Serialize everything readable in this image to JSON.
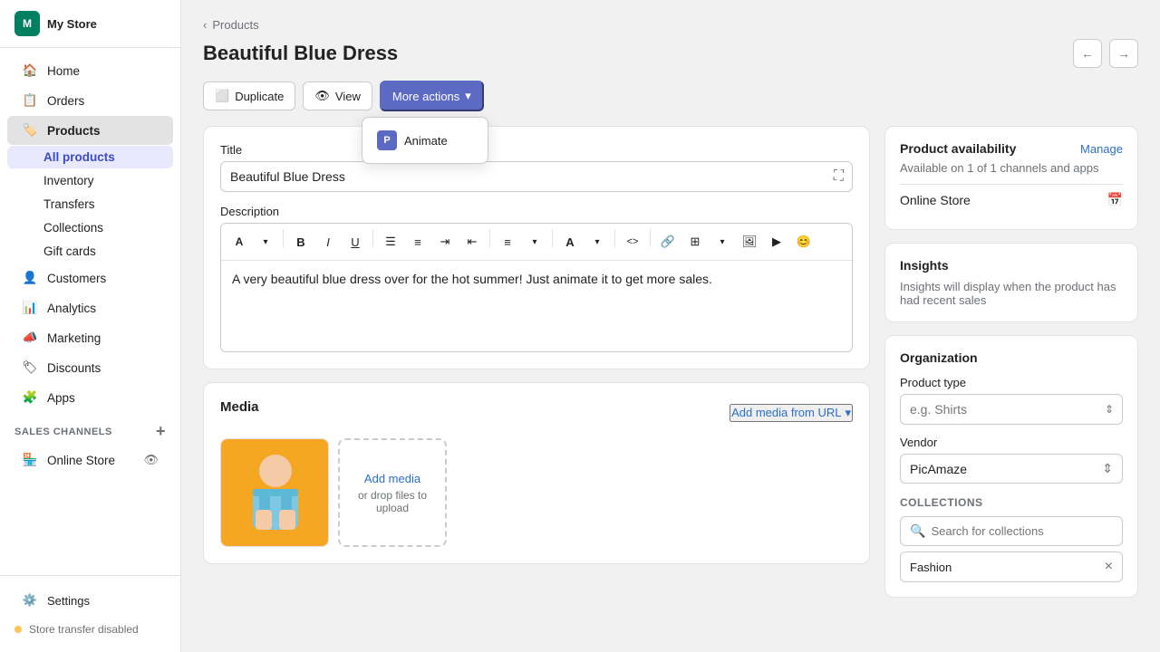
{
  "sidebar": {
    "store": {
      "name": "My Store",
      "initial": "M"
    },
    "nav": [
      {
        "id": "home",
        "label": "Home",
        "icon": "🏠"
      },
      {
        "id": "orders",
        "label": "Orders",
        "icon": "📋"
      },
      {
        "id": "products",
        "label": "Products",
        "icon": "🏷️",
        "active": true
      }
    ],
    "products_sub": [
      {
        "id": "all-products",
        "label": "All products",
        "active": true
      },
      {
        "id": "inventory",
        "label": "Inventory"
      },
      {
        "id": "transfers",
        "label": "Transfers"
      },
      {
        "id": "collections",
        "label": "Collections"
      },
      {
        "id": "gift-cards",
        "label": "Gift cards"
      }
    ],
    "nav2": [
      {
        "id": "customers",
        "label": "Customers",
        "icon": "👤"
      },
      {
        "id": "analytics",
        "label": "Analytics",
        "icon": "📊"
      },
      {
        "id": "marketing",
        "label": "Marketing",
        "icon": "📣"
      },
      {
        "id": "discounts",
        "label": "Discounts",
        "icon": "🏷"
      },
      {
        "id": "apps",
        "label": "Apps",
        "icon": "🧩"
      }
    ],
    "sales_channels_title": "SALES CHANNELS",
    "sales_channels": [
      {
        "id": "online-store",
        "label": "Online Store"
      }
    ],
    "footer": [
      {
        "id": "settings",
        "label": "Settings",
        "icon": "⚙️"
      }
    ],
    "store_status": "Store transfer disabled"
  },
  "breadcrumb": "Products",
  "page_title": "Beautiful Blue Dress",
  "nav_prev": "←",
  "nav_next": "→",
  "actions": {
    "duplicate_label": "Duplicate",
    "view_label": "View",
    "more_actions_label": "More actions",
    "dropdown_items": [
      {
        "id": "animate",
        "label": "Animate",
        "icon": "P"
      }
    ]
  },
  "product_form": {
    "title_label": "Title",
    "title_value": "Beautiful Blue Dress",
    "description_label": "Description",
    "description_text": "A very beautiful blue dress over for the hot summer! Just animate it to get more sales."
  },
  "media_section": {
    "title": "Media",
    "add_media_label": "Add media from URL",
    "upload_label": "Add media",
    "upload_sub": "or drop files to\nupload"
  },
  "right_panel": {
    "availability": {
      "title": "Product availability",
      "manage_label": "Manage",
      "sub_text": "Available on 1 of 1 channels and apps",
      "online_store_label": "Online Store"
    },
    "insights": {
      "title": "Insights",
      "text": "Insights will display when the product has had recent sales"
    },
    "organization": {
      "title": "Organization",
      "product_type_label": "Product type",
      "product_type_placeholder": "e.g. Shirts",
      "vendor_label": "Vendor",
      "vendor_value": "PicAmaze",
      "collections_label": "COLLECTIONS",
      "collections_search_placeholder": "Search for collections",
      "collection_tags": [
        {
          "id": "fashion",
          "label": "Fashion"
        }
      ]
    }
  },
  "icons": {
    "search": "🔍",
    "chevron_down": "▾",
    "x_close": "×",
    "plus": "+",
    "calendar": "📅",
    "back": "‹",
    "duplicate": "⬜",
    "view": "👁",
    "eye": "👁",
    "expand": "⛶"
  }
}
